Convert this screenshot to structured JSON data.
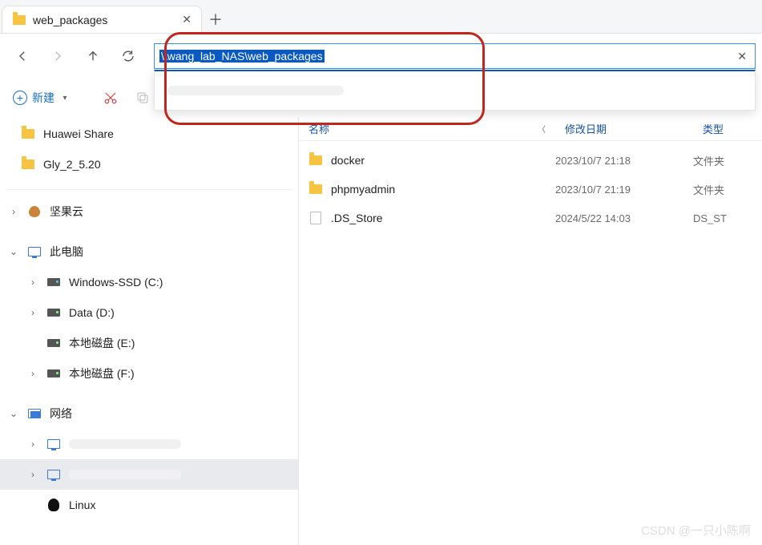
{
  "tab": {
    "title": "web_packages"
  },
  "address": {
    "value": "\\\\wang_lab_NAS\\web_packages",
    "suggestion": "(network path suggestion – obscured)"
  },
  "toolbar": {
    "new_label": "新建"
  },
  "sidebar": {
    "top": [
      {
        "label": "Huawei Share"
      },
      {
        "label": "Gly_2_5.20"
      }
    ],
    "cloud": "坚果云",
    "pc": "此电脑",
    "drives": [
      {
        "label": "Windows-SSD (C:)"
      },
      {
        "label": "Data (D:)"
      },
      {
        "label": "本地磁盘 (E:)"
      },
      {
        "label": "本地磁盘 (F:)"
      }
    ],
    "network": "网络",
    "net_items": [
      {
        "label": "(redacted)"
      },
      {
        "label": "(redacted)"
      },
      {
        "label": "Linux"
      }
    ]
  },
  "columns": {
    "name": "名称",
    "date": "修改日期",
    "type": "类型"
  },
  "files": [
    {
      "name": "docker",
      "date": "2023/10/7 21:18",
      "type": "文件夹",
      "kind": "folder"
    },
    {
      "name": "phpmyadmin",
      "date": "2023/10/7 21:19",
      "type": "文件夹",
      "kind": "folder"
    },
    {
      "name": ".DS_Store",
      "date": "2024/5/22 14:03",
      "type": "DS_ST",
      "kind": "file"
    }
  ],
  "watermark": "CSDN @一只小陈啊"
}
